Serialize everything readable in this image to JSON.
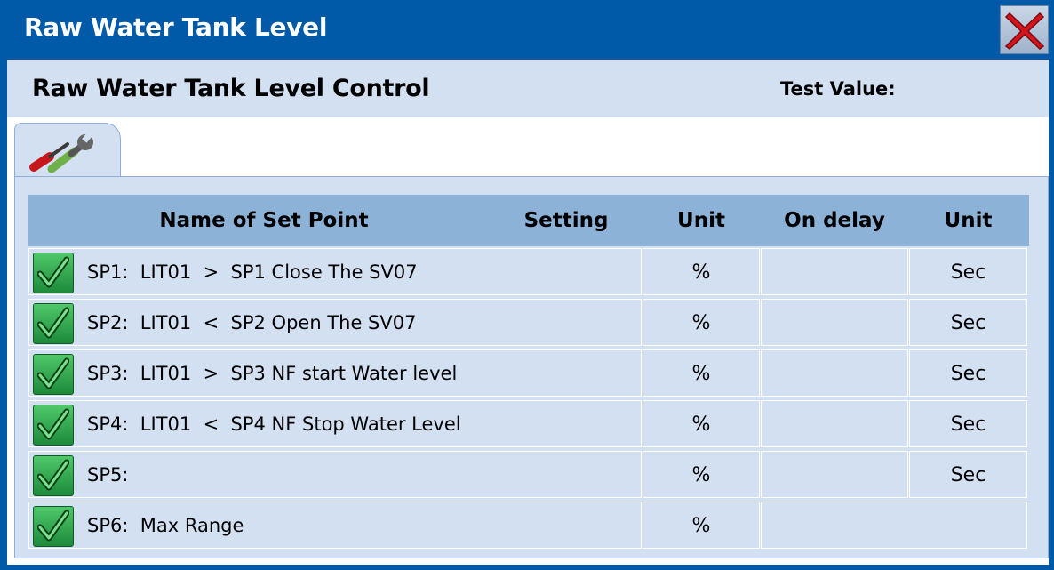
{
  "window": {
    "title": "Raw Water Tank Level"
  },
  "header": {
    "subtitle": "Raw Water Tank Level Control",
    "test_value_label": "Test Value:"
  },
  "tabs": [
    {
      "icon": "tools-icon"
    }
  ],
  "table": {
    "columns": [
      "Name of Set Point",
      "Setting",
      "Unit",
      "On delay",
      "Unit"
    ],
    "rows": [
      {
        "name": "SP1:  LIT01  >  SP1 Close The SV07",
        "unit": "%",
        "delay_unit": "Sec"
      },
      {
        "name": "SP2:  LIT01  <  SP2 Open The SV07",
        "unit": "%",
        "delay_unit": "Sec"
      },
      {
        "name": "SP3:  LIT01  >  SP3 NF start Water level",
        "unit": "%",
        "delay_unit": "Sec"
      },
      {
        "name": "SP4:  LIT01  <  SP4 NF Stop Water Level",
        "unit": "%",
        "delay_unit": "Sec"
      },
      {
        "name": "SP5:",
        "unit": "%",
        "delay_unit": "Sec"
      },
      {
        "name": "SP6:  Max Range",
        "unit": "%",
        "delay_unit": null
      }
    ]
  },
  "colors": {
    "title_bar": "#005aa8",
    "panel": "#d3e0f1",
    "header_row": "#8db2d8",
    "check": "#2aa24a"
  }
}
